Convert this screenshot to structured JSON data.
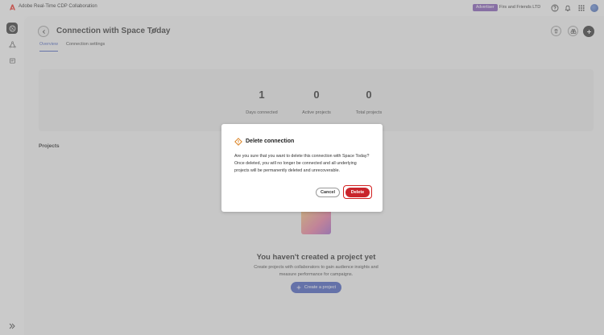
{
  "app": {
    "title": "Adobe Real-Time CDP Collaboration"
  },
  "header": {
    "role_badge": "Advertiser",
    "org_name": "Firs and Friends LTD"
  },
  "page": {
    "title": "Connection with Space Today",
    "tabs": [
      {
        "label": "Overview",
        "active": true
      },
      {
        "label": "Connection settings",
        "active": false
      }
    ]
  },
  "stats": [
    {
      "value": "1",
      "label": "Days connected"
    },
    {
      "value": "0",
      "label": "Active projects"
    },
    {
      "value": "0",
      "label": "Total projects"
    }
  ],
  "projects": {
    "section_title": "Projects",
    "empty_title": "You haven't created a project yet",
    "empty_desc": "Create projects with collaborators to gain audience insights and measure performance for campaigns.",
    "create_label": "Create a project"
  },
  "dialog": {
    "title": "Delete connection",
    "body": "Are you sure that you want to delete this connection with Space Today? Once deleted, you will no longer be connected and all underlying projects will be permanently deleted and unrecoverable.",
    "cancel_label": "Cancel",
    "delete_label": "Delete"
  },
  "colors": {
    "accent": "#3c55b8",
    "danger": "#c9252c",
    "badge": "#7b4fb0",
    "highlight": "#d32020"
  }
}
